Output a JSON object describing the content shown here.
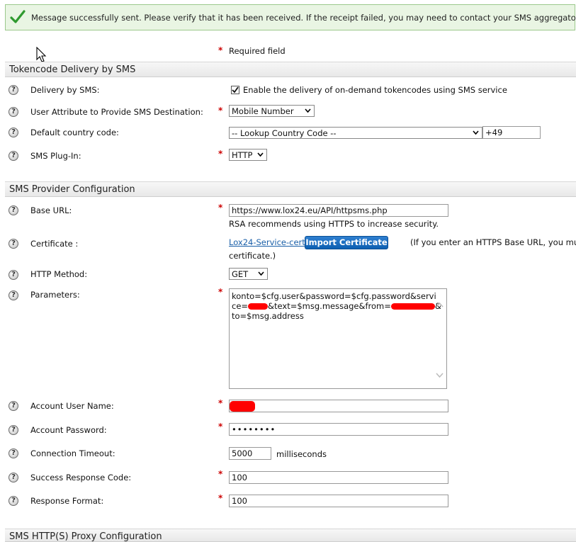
{
  "banner": {
    "message": "Message successfully sent. Please verify that it has been received. If the receipt failed, you may need to contact your SMS aggregator."
  },
  "required_note": {
    "star": "*",
    "text": "Required field"
  },
  "sections": {
    "tokencode": "Tokencode Delivery by SMS",
    "provider": "SMS Provider Configuration",
    "proxy": "SMS HTTP(S) Proxy Configuration"
  },
  "help_glyph": "?",
  "fields": {
    "delivery": {
      "label": "Delivery by SMS:",
      "checked": true,
      "checkbox_label": "Enable the delivery of on-demand tokencodes using SMS service"
    },
    "user_attribute": {
      "label": "User Attribute to Provide SMS Destination:",
      "value": "Mobile Number"
    },
    "country_code": {
      "label": "Default country code:",
      "value": "-- Lookup Country Code --",
      "code_value": "+49"
    },
    "plugin": {
      "label": "SMS Plug-In:",
      "value": "HTTP"
    },
    "base_url": {
      "label": "Base URL:",
      "value": "https://www.lox24.eu/API/httpsms.php",
      "hint": "RSA recommends using HTTPS to increase security."
    },
    "certificate": {
      "label": "Certificate :",
      "link": "Lox24-Service-cert",
      "button": "Import Certificate",
      "note": "(If you enter an HTTPS Base URL, you mu",
      "note_cont": "certificate.)"
    },
    "http_method": {
      "label": "HTTP Method:",
      "value": "GET"
    },
    "parameters": {
      "label": "Parameters:",
      "line1": "konto=$cfg.user&password=$cfg.password&servi",
      "line2_a": "ce=",
      "line2_b": "&text=$msg.message&from=",
      "line2_c": "&",
      "line3": "to=$msg.address"
    },
    "account_user": {
      "label": "Account User Name:",
      "value": ""
    },
    "account_password": {
      "label": "Account Password:",
      "value": "••••••••"
    },
    "timeout": {
      "label": "Connection Timeout:",
      "value": "5000",
      "unit": "milliseconds"
    },
    "success_code": {
      "label": "Success Response Code:",
      "value": "100"
    },
    "response_format": {
      "label": "Response Format:",
      "value": "100"
    }
  },
  "colors": {
    "banner_bg": "#e9f5e3",
    "banner_border": "#9cc98c",
    "required_star": "#cc0000",
    "button_blue": "#0d5fb1",
    "link_blue": "#1a5fa8",
    "redaction": "#ff0000"
  },
  "icons": {
    "banner": "green-checkmark-icon",
    "help": "help-question-icon",
    "dropdown": "chevron-down-icon",
    "cursor": "mouse-pointer-icon"
  }
}
